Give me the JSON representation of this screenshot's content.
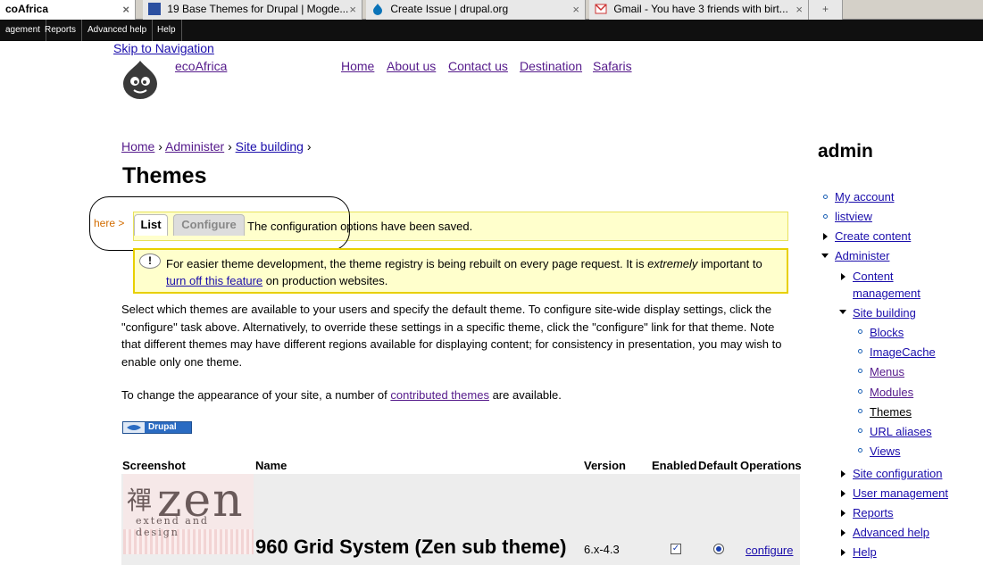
{
  "browser": {
    "tabs": [
      {
        "title": "coAfrica",
        "active": true
      },
      {
        "title": "19 Base Themes for Drupal | Mogde...",
        "active": false
      },
      {
        "title": "Create Issue | drupal.org",
        "active": false
      },
      {
        "title": "Gmail - You have 3 friends with birt...",
        "active": false
      }
    ],
    "close_glyph": "×",
    "new_tab_glyph": "+"
  },
  "admin_menu": {
    "items": [
      "agement",
      "Reports",
      "Advanced help",
      "Help"
    ]
  },
  "header": {
    "skip_link": "Skip to Navigation",
    "site_name": "ecoAfrica",
    "primary_links": [
      "Home",
      "About us",
      "Contact us",
      "Destination",
      "Safaris"
    ]
  },
  "breadcrumb": {
    "items": [
      "Home",
      "Administer",
      "Site building"
    ],
    "separator": "›"
  },
  "page": {
    "title": "Themes",
    "tabs": {
      "list": "List",
      "configure": "Configure"
    },
    "annotation_label": "here >",
    "status_message": "The configuration options have been saved.",
    "warning": {
      "icon_glyph": "!",
      "text_before": "For easier theme development, the theme registry is being rebuilt on every page request. It is ",
      "emphasis": "extremely",
      "text_after": " important to",
      "link": "turn off this feature",
      "text_end": " on production websites."
    },
    "intro": "Select which themes are available to your users and specify the default theme. To configure site-wide display settings, click the \"configure\" task above. Alternatively, to override these settings in a specific theme, click the \"configure\" link for that theme. Note that different themes may have different regions available for displaying content; for consistency in presentation, you may wish to enable only one theme.",
    "appearance": {
      "before": "To change the appearance of your site, a number of ",
      "link": "contributed themes",
      "after": " are available."
    },
    "badge_label": "Drupal"
  },
  "table": {
    "headers": [
      "Screenshot",
      "Name",
      "Version",
      "Enabled",
      "Default",
      "Operations"
    ],
    "rows": [
      {
        "screenshot": {
          "glyph": "禪",
          "word": "zen",
          "sub": "extend and design"
        },
        "name": "960 Grid System (Zen sub theme)",
        "version": "6.x-4.3",
        "enabled": true,
        "default": true,
        "operation": "configure"
      }
    ]
  },
  "sidebar": {
    "title": "admin",
    "items": {
      "my_account": "My account",
      "listview": "listview",
      "create_content": "Create content",
      "administer": "Administer",
      "content_management": "Content management",
      "site_building": "Site building",
      "blocks": "Blocks",
      "imagecache": "ImageCache",
      "menus": "Menus",
      "modules": "Modules",
      "themes": "Themes",
      "url_aliases": "URL aliases",
      "views": "Views",
      "site_configuration": "Site configuration",
      "user_management": "User management",
      "reports": "Reports",
      "advanced_help": "Advanced help",
      "help": "Help"
    }
  },
  "colors": {
    "link": "#1a0dab",
    "status_bg": "#ffffcc",
    "warning_border": "#e8d000",
    "annotation": "#d26c00",
    "admin_bar": "#101010"
  }
}
